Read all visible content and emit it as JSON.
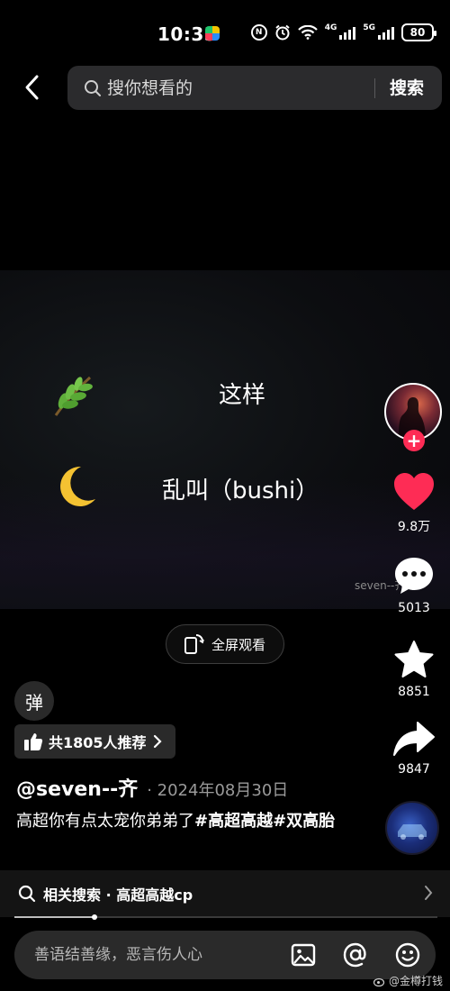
{
  "status_bar": {
    "time": "10:35",
    "battery": "80",
    "network_1": "4G",
    "network_2": "5G",
    "nfc_badge": "N"
  },
  "header": {
    "search_placeholder": "搜你想看的",
    "search_button": "搜索"
  },
  "video": {
    "line1": "这样",
    "line2": "乱叫（bushi）",
    "watermark": "seven--齐",
    "icons": [
      "leaf-icon",
      "moon-icon"
    ]
  },
  "actions": {
    "likes": "9.8万",
    "comments": "5013",
    "favorites": "8851",
    "shares": "9847",
    "follow_symbol": "+"
  },
  "fullscreen_label": "全屏观看",
  "danmu_label": "弹",
  "recommend_label": "共1805人推荐",
  "post": {
    "author": "@seven--齐",
    "date": "2024年08月30日",
    "desc_text": "高超你有点太宠你弟弟了",
    "tag1": "#高超高越",
    "tag2": "#双高胎"
  },
  "related_search": "相关搜索 · 高超高越cp",
  "playback_progress": 0.19,
  "comment_placeholder": "善语结善缘，恶言伤人心",
  "weibo_credit": "@金樽打钱",
  "colors": {
    "accent_red": "#fe2c55",
    "like_red": "#fe2c55",
    "background": "#000000"
  }
}
